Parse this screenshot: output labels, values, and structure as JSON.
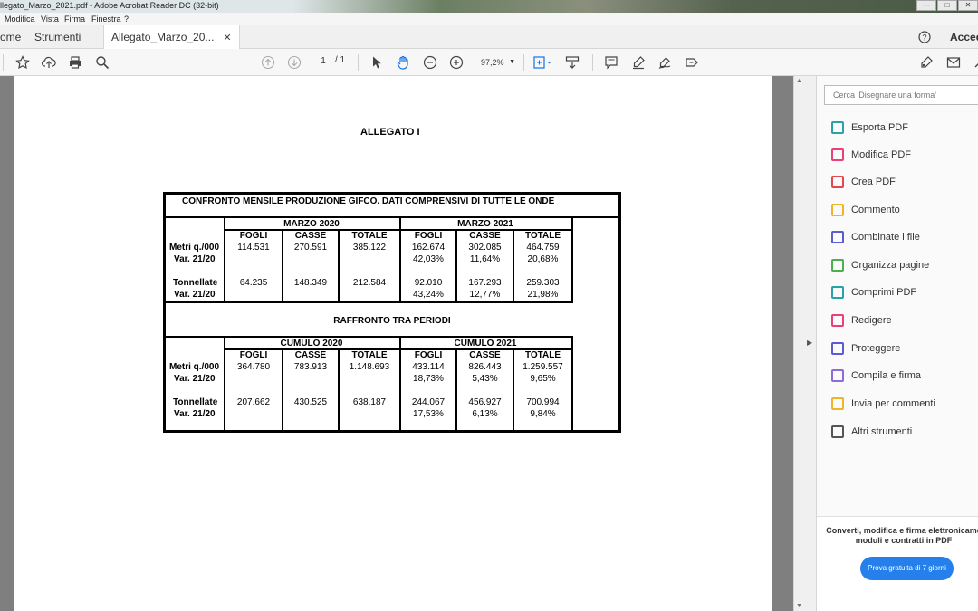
{
  "window": {
    "title": "llegato_Marzo_2021.pdf - Adobe Acrobat Reader DC (32-bit)",
    "buttons": [
      "—",
      "□",
      "✕"
    ]
  },
  "menu": [
    "Modifica",
    "Vista",
    "Firma",
    "Finestra",
    "?"
  ],
  "tabs": {
    "home": "ome",
    "tools": "Strumenti",
    "doc": "Allegato_Marzo_20...",
    "close": "✕",
    "signin": "Acced"
  },
  "toolbar": {
    "page_current": "1",
    "page_total": "/ 1",
    "zoom": "97,2%"
  },
  "document": {
    "heading": "ALLEGATO I",
    "table_title": "CONFRONTO MENSILE PRODUZIONE GIFCO. DATI COMPRENSIVI DI TUTTE LE ONDE",
    "section_title": "RAFFRONTO TRA PERIODI",
    "col_headers": [
      "FOGLI",
      "CASSE",
      "TOTALE"
    ],
    "top": {
      "period_a": "MARZO 2020",
      "period_b": "MARZO 2021",
      "rows": [
        {
          "label": "Metri q./000",
          "a": [
            "114.531",
            "270.591",
            "385.122"
          ],
          "b": [
            "162.674",
            "302.085",
            "464.759"
          ]
        },
        {
          "label": "Var. 21/20",
          "a": [
            "",
            "",
            ""
          ],
          "b": [
            "42,03%",
            "11,64%",
            "20,68%"
          ]
        },
        {
          "label": "Tonnellate",
          "a": [
            "64.235",
            "148.349",
            "212.584"
          ],
          "b": [
            "92.010",
            "167.293",
            "259.303"
          ]
        },
        {
          "label": "Var. 21/20",
          "a": [
            "",
            "",
            ""
          ],
          "b": [
            "43,24%",
            "12,77%",
            "21,98%"
          ]
        }
      ]
    },
    "bottom": {
      "period_a": "CUMULO 2020",
      "period_b": "CUMULO 2021",
      "rows": [
        {
          "label": "Metri q./000",
          "a": [
            "364.780",
            "783.913",
            "1.148.693"
          ],
          "b": [
            "433.114",
            "826.443",
            "1.259.557"
          ]
        },
        {
          "label": "Var. 21/20",
          "a": [
            "",
            "",
            ""
          ],
          "b": [
            "18,73%",
            "5,43%",
            "9,65%"
          ]
        },
        {
          "label": "Tonnellate",
          "a": [
            "207.662",
            "430.525",
            "638.187"
          ],
          "b": [
            "244.067",
            "456.927",
            "700.994"
          ]
        },
        {
          "label": "Var. 21/20",
          "a": [
            "",
            "",
            ""
          ],
          "b": [
            "17,53%",
            "6,13%",
            "9,84%"
          ]
        }
      ]
    }
  },
  "right_panel": {
    "search_placeholder": "Cerca 'Disegnare una forma'",
    "tools": [
      {
        "label": "Esporta PDF",
        "icon": "export-pdf-icon",
        "color": "#2aa2a8"
      },
      {
        "label": "Modifica PDF",
        "icon": "edit-pdf-icon",
        "color": "#e8417a"
      },
      {
        "label": "Crea PDF",
        "icon": "create-pdf-icon",
        "color": "#e34850"
      },
      {
        "label": "Commento",
        "icon": "comment-icon",
        "color": "#f0b429"
      },
      {
        "label": "Combinate i file",
        "icon": "combine-files-icon",
        "color": "#5b5bd6"
      },
      {
        "label": "Organizza pagine",
        "icon": "organize-pages-icon",
        "color": "#4caf50"
      },
      {
        "label": "Comprimi PDF",
        "icon": "compress-pdf-icon",
        "color": "#2aa2a8"
      },
      {
        "label": "Redigere",
        "icon": "redact-icon",
        "color": "#e8417a"
      },
      {
        "label": "Proteggere",
        "icon": "protect-icon",
        "color": "#5b5bd6"
      },
      {
        "label": "Compila e firma",
        "icon": "fill-sign-icon",
        "color": "#8e6bd6"
      },
      {
        "label": "Invia per commenti",
        "icon": "send-comments-icon",
        "color": "#f0b429"
      },
      {
        "label": "Altri strumenti",
        "icon": "more-tools-icon",
        "color": "#555555"
      }
    ],
    "promo_text": "Converti, modifica e firma elettronicame moduli e contratti in PDF",
    "promo_button": "Prova gratuita di 7 giorni"
  }
}
